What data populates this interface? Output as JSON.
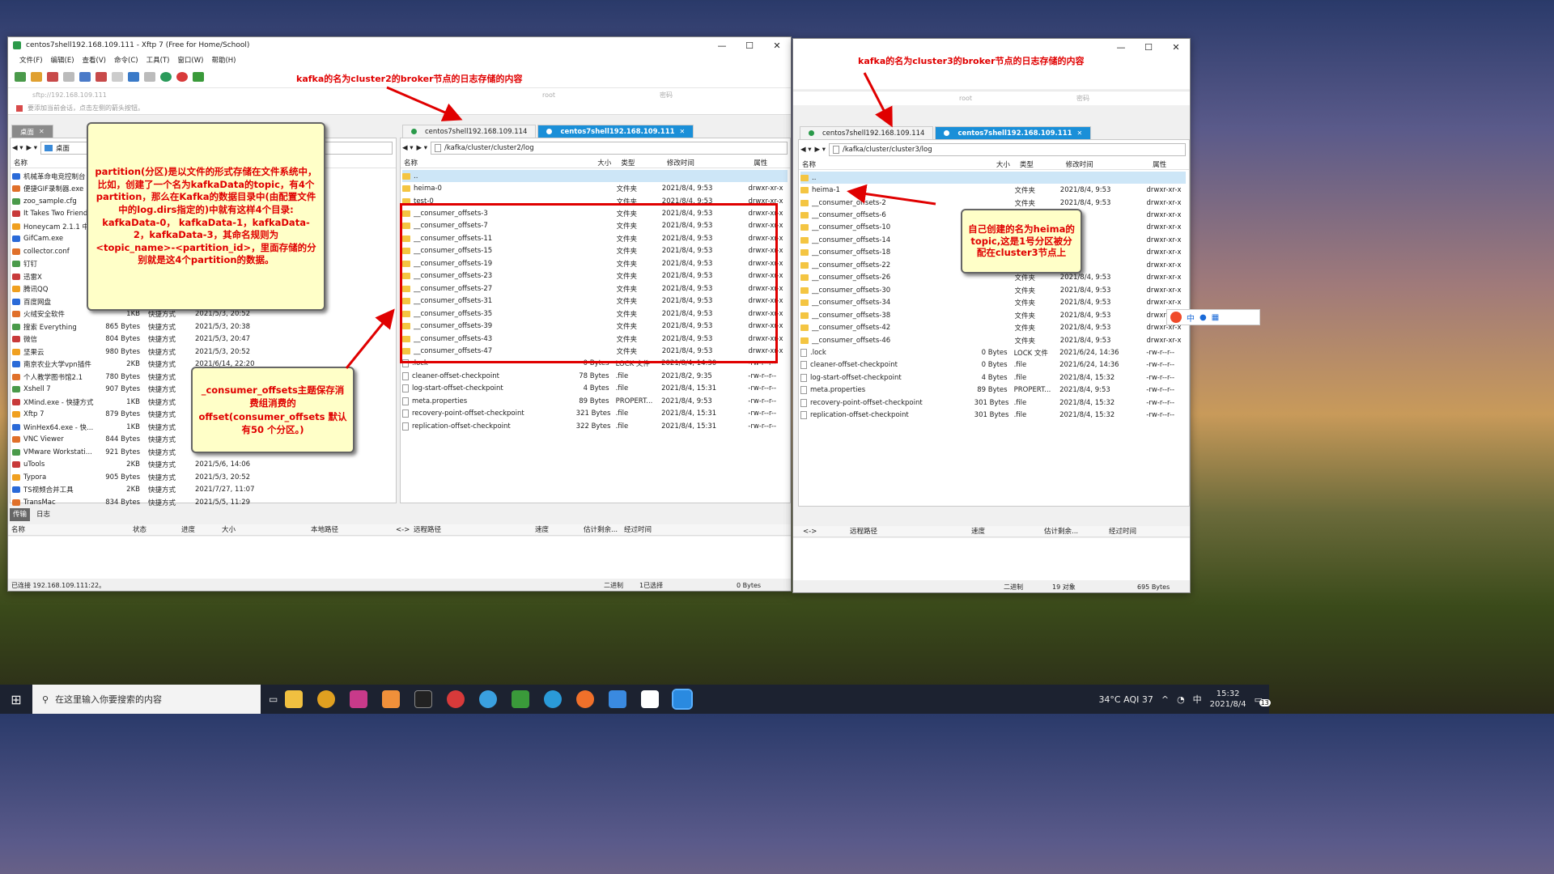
{
  "left_window": {
    "title": "centos7shell192.168.109.111 - Xftp 7 (Free for Home/School)",
    "menu": [
      "文件(F)",
      "编辑(E)",
      "查看(V)",
      "命令(C)",
      "工具(T)",
      "窗口(W)",
      "帮助(H)"
    ],
    "address_placeholder": "sftp://192.168.109.111",
    "user_value": "root",
    "password_placeholder": "密码",
    "hint": "要添加当前会话，点击左侧的箭头按钮。",
    "local_tab": "桌面",
    "local_path": "桌面",
    "local_col_name": "名称",
    "local_files": [
      {
        "name": "机械革命电竞控制台",
        "size": "",
        "type": "",
        "date": ""
      },
      {
        "name": "便捷GIF录制器.exe",
        "size": "",
        "type": "",
        "date": ""
      },
      {
        "name": "zoo_sample.cfg",
        "size": "",
        "type": "",
        "date": ""
      },
      {
        "name": "It Takes Two Friend",
        "size": "",
        "type": "",
        "date": ""
      },
      {
        "name": "Honeycam 2.1.1 中",
        "size": "",
        "type": "",
        "date": ""
      },
      {
        "name": "GifCam.exe",
        "size": "",
        "type": "",
        "date": ""
      },
      {
        "name": "collector.conf",
        "size": "",
        "type": "",
        "date": ""
      },
      {
        "name": "钉钉",
        "size": "",
        "type": "",
        "date": ""
      },
      {
        "name": "迅雷X",
        "size": "",
        "type": "",
        "date": ""
      },
      {
        "name": "腾讯QQ",
        "size": "",
        "type": "",
        "date": ""
      },
      {
        "name": "百度网盘",
        "size": "",
        "type": "",
        "date": ""
      },
      {
        "name": "火绒安全软件",
        "size": "1KB",
        "type": "快捷方式",
        "date": "2021/5/3, 20:52"
      },
      {
        "name": "搜索 Everything",
        "size": "865 Bytes",
        "type": "快捷方式",
        "date": "2021/5/3, 20:38"
      },
      {
        "name": "微信",
        "size": "804 Bytes",
        "type": "快捷方式",
        "date": "2021/5/3, 20:47"
      },
      {
        "name": "坚果云",
        "size": "980 Bytes",
        "type": "快捷方式",
        "date": "2021/5/3, 20:52"
      },
      {
        "name": "南京农业大学vpn插件",
        "size": "2KB",
        "type": "快捷方式",
        "date": "2021/6/14, 22:20"
      },
      {
        "name": "个人教学图书馆2.1",
        "size": "780 Bytes",
        "type": "快捷方式",
        "date": ""
      },
      {
        "name": "Xshell 7",
        "size": "907 Bytes",
        "type": "快捷方式",
        "date": ""
      },
      {
        "name": "XMind.exe - 快捷方式",
        "size": "1KB",
        "type": "快捷方式",
        "date": ""
      },
      {
        "name": "Xftp 7",
        "size": "879 Bytes",
        "type": "快捷方式",
        "date": ""
      },
      {
        "name": "WinHex64.exe - 快...",
        "size": "1KB",
        "type": "快捷方式",
        "date": ""
      },
      {
        "name": "VNC Viewer",
        "size": "844 Bytes",
        "type": "快捷方式",
        "date": ""
      },
      {
        "name": "VMware Workstati...",
        "size": "921 Bytes",
        "type": "快捷方式",
        "date": ""
      },
      {
        "name": "uTools",
        "size": "2KB",
        "type": "快捷方式",
        "date": "2021/5/6, 14:06"
      },
      {
        "name": "Typora",
        "size": "905 Bytes",
        "type": "快捷方式",
        "date": "2021/5/3, 20:52"
      },
      {
        "name": "TS视频合并工具",
        "size": "2KB",
        "type": "快捷方式",
        "date": "2021/7/27, 11:07"
      },
      {
        "name": "TransMac",
        "size": "834 Bytes",
        "type": "快捷方式",
        "date": "2021/5/5, 11:29"
      }
    ],
    "remote_tabs": [
      "centos7shell192.168.109.114",
      "centos7shell192.168.109.111"
    ],
    "remote_path": "/kafka/cluster/cluster2/log",
    "cols": [
      "名称",
      "大小",
      "类型",
      "修改时间",
      "属性"
    ],
    "remote_files": [
      {
        "name": "..",
        "size": "",
        "type": "",
        "date": "",
        "attr": "",
        "kind": "up"
      },
      {
        "name": "heima-0",
        "size": "",
        "type": "文件夹",
        "date": "2021/8/4, 9:53",
        "attr": "drwxr-xr-x",
        "kind": "folder"
      },
      {
        "name": "test-0",
        "size": "",
        "type": "文件夹",
        "date": "2021/8/4, 9:53",
        "attr": "drwxr-xr-x",
        "kind": "folder"
      },
      {
        "name": "__consumer_offsets-3",
        "size": "",
        "type": "文件夹",
        "date": "2021/8/4, 9:53",
        "attr": "drwxr-xr-x",
        "kind": "folder"
      },
      {
        "name": "__consumer_offsets-7",
        "size": "",
        "type": "文件夹",
        "date": "2021/8/4, 9:53",
        "attr": "drwxr-xr-x",
        "kind": "folder"
      },
      {
        "name": "__consumer_offsets-11",
        "size": "",
        "type": "文件夹",
        "date": "2021/8/4, 9:53",
        "attr": "drwxr-xr-x",
        "kind": "folder"
      },
      {
        "name": "__consumer_offsets-15",
        "size": "",
        "type": "文件夹",
        "date": "2021/8/4, 9:53",
        "attr": "drwxr-xr-x",
        "kind": "folder"
      },
      {
        "name": "__consumer_offsets-19",
        "size": "",
        "type": "文件夹",
        "date": "2021/8/4, 9:53",
        "attr": "drwxr-xr-x",
        "kind": "folder"
      },
      {
        "name": "__consumer_offsets-23",
        "size": "",
        "type": "文件夹",
        "date": "2021/8/4, 9:53",
        "attr": "drwxr-xr-x",
        "kind": "folder"
      },
      {
        "name": "__consumer_offsets-27",
        "size": "",
        "type": "文件夹",
        "date": "2021/8/4, 9:53",
        "attr": "drwxr-xr-x",
        "kind": "folder"
      },
      {
        "name": "__consumer_offsets-31",
        "size": "",
        "type": "文件夹",
        "date": "2021/8/4, 9:53",
        "attr": "drwxr-xr-x",
        "kind": "folder"
      },
      {
        "name": "__consumer_offsets-35",
        "size": "",
        "type": "文件夹",
        "date": "2021/8/4, 9:53",
        "attr": "drwxr-xr-x",
        "kind": "folder"
      },
      {
        "name": "__consumer_offsets-39",
        "size": "",
        "type": "文件夹",
        "date": "2021/8/4, 9:53",
        "attr": "drwxr-xr-x",
        "kind": "folder"
      },
      {
        "name": "__consumer_offsets-43",
        "size": "",
        "type": "文件夹",
        "date": "2021/8/4, 9:53",
        "attr": "drwxr-xr-x",
        "kind": "folder"
      },
      {
        "name": "__consumer_offsets-47",
        "size": "",
        "type": "文件夹",
        "date": "2021/8/4, 9:53",
        "attr": "drwxr-xr-x",
        "kind": "folder"
      },
      {
        "name": ".lock",
        "size": "0 Bytes",
        "type": "LOCK 文件",
        "date": "2021/8/4, 14:30",
        "attr": "-rw-r--r--",
        "kind": "file"
      },
      {
        "name": "cleaner-offset-checkpoint",
        "size": "78 Bytes",
        "type": ".file",
        "date": "2021/8/2, 9:35",
        "attr": "-rw-r--r--",
        "kind": "file"
      },
      {
        "name": "log-start-offset-checkpoint",
        "size": "4 Bytes",
        "type": ".file",
        "date": "2021/8/4, 15:31",
        "attr": "-rw-r--r--",
        "kind": "file"
      },
      {
        "name": "meta.properties",
        "size": "89 Bytes",
        "type": "PROPERT...",
        "date": "2021/8/4, 9:53",
        "attr": "-rw-r--r--",
        "kind": "file"
      },
      {
        "name": "recovery-point-offset-checkpoint",
        "size": "321 Bytes",
        "type": ".file",
        "date": "2021/8/4, 15:31",
        "attr": "-rw-r--r--",
        "kind": "file"
      },
      {
        "name": "replication-offset-checkpoint",
        "size": "322 Bytes",
        "type": ".file",
        "date": "2021/8/4, 15:31",
        "attr": "-rw-r--r--",
        "kind": "file"
      }
    ],
    "transfer_tabs": [
      "传输",
      "日志"
    ],
    "transfer_cols": [
      "名称",
      "状态",
      "进度",
      "大小",
      "本地路径",
      "<->",
      "远程路径",
      "速度",
      "估计剩余...",
      "经过时间"
    ],
    "status_left": "已连接 192.168.109.111:22。",
    "status_mode": "二进制",
    "status_sel": "1已选择",
    "status_size": "0 Bytes"
  },
  "right_window": {
    "user_value": "root",
    "password_placeholder": "密码",
    "remote_tabs": [
      "centos7shell192.168.109.114",
      "centos7shell192.168.109.111"
    ],
    "remote_path": "/kafka/cluster/cluster3/log",
    "cols": [
      "名称",
      "大小",
      "类型",
      "修改时间",
      "属性"
    ],
    "remote_files": [
      {
        "name": "..",
        "size": "",
        "type": "",
        "date": "",
        "attr": "",
        "kind": "up"
      },
      {
        "name": "heima-1",
        "size": "",
        "type": "文件夹",
        "date": "2021/8/4, 9:53",
        "attr": "drwxr-xr-x",
        "kind": "folder"
      },
      {
        "name": "__consumer_offsets-2",
        "size": "",
        "type": "文件夹",
        "date": "2021/8/4, 9:53",
        "attr": "drwxr-xr-x",
        "kind": "folder"
      },
      {
        "name": "__consumer_offsets-6",
        "size": "",
        "type": "",
        "date": "9:53",
        "attr": "drwxr-xr-x",
        "kind": "folder"
      },
      {
        "name": "__consumer_offsets-10",
        "size": "",
        "type": "",
        "date": "9:53",
        "attr": "drwxr-xr-x",
        "kind": "folder"
      },
      {
        "name": "__consumer_offsets-14",
        "size": "",
        "type": "",
        "date": "9:53",
        "attr": "drwxr-xr-x",
        "kind": "folder"
      },
      {
        "name": "__consumer_offsets-18",
        "size": "",
        "type": "",
        "date": "9:53",
        "attr": "drwxr-xr-x",
        "kind": "folder"
      },
      {
        "name": "__consumer_offsets-22",
        "size": "",
        "type": "",
        "date": "9:53",
        "attr": "drwxr-xr-x",
        "kind": "folder"
      },
      {
        "name": "__consumer_offsets-26",
        "size": "",
        "type": "文件夹",
        "date": "2021/8/4, 9:53",
        "attr": "drwxr-xr-x",
        "kind": "folder"
      },
      {
        "name": "__consumer_offsets-30",
        "size": "",
        "type": "文件夹",
        "date": "2021/8/4, 9:53",
        "attr": "drwxr-xr-x",
        "kind": "folder"
      },
      {
        "name": "__consumer_offsets-34",
        "size": "",
        "type": "文件夹",
        "date": "2021/8/4, 9:53",
        "attr": "drwxr-xr-x",
        "kind": "folder"
      },
      {
        "name": "__consumer_offsets-38",
        "size": "",
        "type": "文件夹",
        "date": "2021/8/4, 9:53",
        "attr": "drwxr-xr-x",
        "kind": "folder"
      },
      {
        "name": "__consumer_offsets-42",
        "size": "",
        "type": "文件夹",
        "date": "2021/8/4, 9:53",
        "attr": "drwxr-xr-x",
        "kind": "folder"
      },
      {
        "name": "__consumer_offsets-46",
        "size": "",
        "type": "文件夹",
        "date": "2021/8/4, 9:53",
        "attr": "drwxr-xr-x",
        "kind": "folder"
      },
      {
        "name": ".lock",
        "size": "0 Bytes",
        "type": "LOCK 文件",
        "date": "2021/6/24, 14:36",
        "attr": "-rw-r--r--",
        "kind": "file"
      },
      {
        "name": "cleaner-offset-checkpoint",
        "size": "0 Bytes",
        "type": ".file",
        "date": "2021/6/24, 14:36",
        "attr": "-rw-r--r--",
        "kind": "file"
      },
      {
        "name": "log-start-offset-checkpoint",
        "size": "4 Bytes",
        "type": ".file",
        "date": "2021/8/4, 15:32",
        "attr": "-rw-r--r--",
        "kind": "file"
      },
      {
        "name": "meta.properties",
        "size": "89 Bytes",
        "type": "PROPERT...",
        "date": "2021/8/4, 9:53",
        "attr": "-rw-r--r--",
        "kind": "file"
      },
      {
        "name": "recovery-point-offset-checkpoint",
        "size": "301 Bytes",
        "type": ".file",
        "date": "2021/8/4, 15:32",
        "attr": "-rw-r--r--",
        "kind": "file"
      },
      {
        "name": "replication-offset-checkpoint",
        "size": "301 Bytes",
        "type": ".file",
        "date": "2021/8/4, 15:32",
        "attr": "-rw-r--r--",
        "kind": "file"
      }
    ],
    "transfer_cols": [
      "<->",
      "远程路径",
      "速度",
      "估计剩余...",
      "经过时间"
    ],
    "status_mode": "二进制",
    "status_count": "19 对象",
    "status_size": "695 Bytes"
  },
  "annotations": {
    "label_cluster2": "kafka的名为cluster2的broker节点的日志存储的内容",
    "label_cluster3": "kafka的名为cluster3的broker节点的日志存储的内容",
    "note_partition": "partition(分区)是以文件的形式存储在文件系统中，比如，创建了一个名为kafkaData的topic，有4个partition，那么在Kafka的数据目录中(由配置文件中的log.dirs指定的)中就有这样4个目录: kafkaData-0， kafkaData-1，kafkaData-2，kafkaData-3，其命名规则为<topic_name>-<partition_id>，里面存储的分别就是这4个partition的数据。",
    "note_consumer": "_consumer_offsets主题保存消费组消费的offset(consumer_offsets 默认有50 个分区。)",
    "note_heima": "自己创建的名为heima的topic,这是1号分区被分配在cluster3节点上"
  },
  "taskbar": {
    "search_placeholder": "在这里输入你要搜索的内容",
    "weather": "34°C AQI 37",
    "ime": "中",
    "time": "15:32",
    "date": "2021/8/4",
    "notif": "13"
  },
  "colors": {
    "accent": "#1a8fd8",
    "annotation_red": "#e00000",
    "note_bg": "#ffffc8"
  }
}
